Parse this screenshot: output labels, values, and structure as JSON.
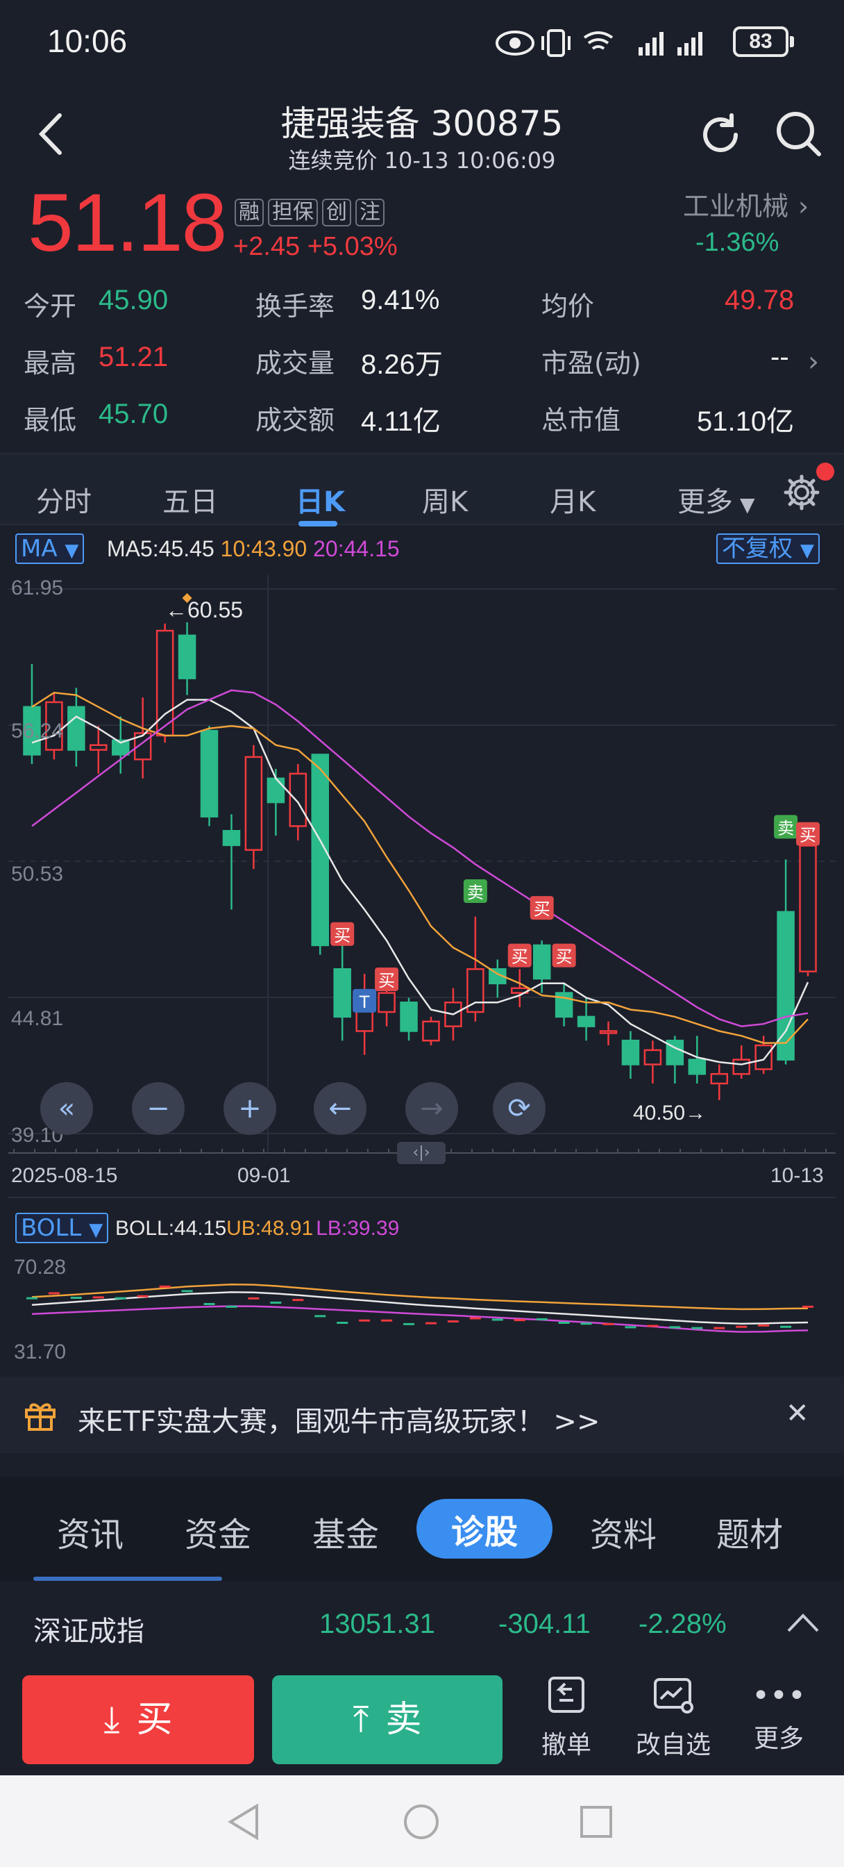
{
  "status": {
    "time": "10:06",
    "battery": "83"
  },
  "header": {
    "title": "捷强装备 300875",
    "subtitle": "连续竞价 10-13 10:06:09"
  },
  "quote": {
    "price": "51.18",
    "tags": [
      "融",
      "担保",
      "创",
      "注"
    ],
    "change": "+2.45  +5.03%",
    "industry": "工业机械",
    "industry_change": "-1.36%"
  },
  "stats": {
    "open_label": "今开",
    "open": "45.90",
    "high_label": "最高",
    "high": "51.21",
    "low_label": "最低",
    "low": "45.70",
    "turnover_label": "换手率",
    "turnover": "9.41%",
    "volume_label": "成交量",
    "volume": "8.26万",
    "amount_label": "成交额",
    "amount": "4.11亿",
    "avg_label": "均价",
    "avg": "49.78",
    "pe_label": "市盈(动)",
    "pe": "--",
    "mcap_label": "总市值",
    "mcap": "51.10亿"
  },
  "ktabs": [
    "分时",
    "五日",
    "日K",
    "周K",
    "月K",
    "更多"
  ],
  "ktab_active": "日K",
  "chart": {
    "ma_label": "MA",
    "ma5": "MA5:45.45",
    "ma10": "10:43.90",
    "ma20": "20:44.15",
    "adjust": "不复权",
    "y_ticks": [
      "61.95",
      "56.24",
      "50.53",
      "44.81",
      "39.10"
    ],
    "x_ticks": [
      "2025-08-15",
      "09-01",
      "10-13"
    ],
    "max_note": "←60.55",
    "min_note": "40.50→",
    "boll_label": "BOLL",
    "boll": "BOLL:44.15",
    "ub": "UB:48.91",
    "lb": "LB:39.39",
    "boll_top": "70.28",
    "boll_bottom": "31.70",
    "signals": [
      "买",
      "卖",
      "T"
    ]
  },
  "chart_data": {
    "type": "candlestick",
    "x_start": "2025-08-15",
    "x_end": "10-13",
    "ylim": [
      39.1,
      61.95
    ],
    "candles": [
      {
        "o": 57.0,
        "c": 55.0,
        "h": 58.8,
        "l": 54.6
      },
      {
        "o": 55.2,
        "c": 57.2,
        "h": 57.6,
        "l": 54.8
      },
      {
        "o": 57.0,
        "c": 55.2,
        "h": 57.8,
        "l": 54.5
      },
      {
        "o": 55.2,
        "c": 55.4,
        "h": 56.2,
        "l": 54.2
      },
      {
        "o": 55.6,
        "c": 55.0,
        "h": 56.6,
        "l": 54.2
      },
      {
        "o": 54.8,
        "c": 55.9,
        "h": 57.4,
        "l": 54.0
      },
      {
        "o": 55.8,
        "c": 60.2,
        "h": 60.5,
        "l": 55.5
      },
      {
        "o": 60.0,
        "c": 58.2,
        "h": 60.55,
        "l": 57.5
      },
      {
        "o": 56.0,
        "c": 52.4,
        "h": 56.2,
        "l": 52.0
      },
      {
        "o": 51.8,
        "c": 51.2,
        "h": 52.5,
        "l": 48.5
      },
      {
        "o": 51.0,
        "c": 54.9,
        "h": 55.4,
        "l": 50.2
      },
      {
        "o": 54.0,
        "c": 53.0,
        "h": 54.4,
        "l": 51.6
      },
      {
        "o": 52.0,
        "c": 54.2,
        "h": 54.6,
        "l": 51.4
      },
      {
        "o": 55.0,
        "c": 47.0,
        "h": 55.0,
        "l": 46.6
      },
      {
        "o": 46.0,
        "c": 44.0,
        "h": 47.5,
        "l": 43.0
      },
      {
        "o": 43.4,
        "c": 45.0,
        "h": 45.8,
        "l": 42.4
      },
      {
        "o": 44.2,
        "c": 45.0,
        "h": 46.0,
        "l": 43.6
      },
      {
        "o": 44.6,
        "c": 43.4,
        "h": 44.8,
        "l": 43.0
      },
      {
        "o": 43.0,
        "c": 43.8,
        "h": 44.0,
        "l": 42.8
      },
      {
        "o": 43.6,
        "c": 44.6,
        "h": 45.2,
        "l": 43.0
      },
      {
        "o": 44.2,
        "c": 46.0,
        "h": 48.2,
        "l": 43.8
      },
      {
        "o": 46.0,
        "c": 45.4,
        "h": 46.4,
        "l": 44.8
      },
      {
        "o": 45.0,
        "c": 45.2,
        "h": 46.0,
        "l": 44.4
      },
      {
        "o": 47.0,
        "c": 45.6,
        "h": 47.2,
        "l": 45.0
      },
      {
        "o": 45.0,
        "c": 44.0,
        "h": 45.4,
        "l": 43.6
      },
      {
        "o": 44.0,
        "c": 43.6,
        "h": 44.8,
        "l": 43.0
      },
      {
        "o": 43.4,
        "c": 43.4,
        "h": 43.8,
        "l": 42.8
      },
      {
        "o": 43.0,
        "c": 42.0,
        "h": 43.4,
        "l": 41.4
      },
      {
        "o": 42.0,
        "c": 42.6,
        "h": 43.0,
        "l": 41.2
      },
      {
        "o": 43.0,
        "c": 42.0,
        "h": 43.2,
        "l": 41.2
      },
      {
        "o": 42.2,
        "c": 41.6,
        "h": 43.2,
        "l": 41.2
      },
      {
        "o": 41.2,
        "c": 41.6,
        "h": 42.0,
        "l": 40.5
      },
      {
        "o": 41.6,
        "c": 42.2,
        "h": 42.8,
        "l": 41.4
      },
      {
        "o": 41.8,
        "c": 42.8,
        "h": 43.2,
        "l": 41.6
      },
      {
        "o": 48.4,
        "c": 42.2,
        "h": 50.6,
        "l": 42.0
      },
      {
        "o": 45.9,
        "c": 51.18,
        "h": 51.21,
        "l": 45.7
      }
    ],
    "ma5": [
      55.5,
      55.8,
      56.6,
      56.1,
      55.5,
      55.8,
      56.7,
      57.3,
      57.3,
      56.8,
      56.1,
      54.0,
      53.0,
      51.4,
      49.7,
      48.5,
      47.2,
      45.6,
      44.3,
      44.1,
      44.6,
      44.6,
      44.9,
      45.4,
      45.4,
      44.8,
      44.5,
      43.7,
      43.2,
      42.7,
      42.3,
      42.1,
      42.0,
      42.2,
      43.4,
      45.45
    ],
    "ma10": [
      57.0,
      57.6,
      57.5,
      57.0,
      56.5,
      56.1,
      55.8,
      55.8,
      56.1,
      56.2,
      56.1,
      55.4,
      55.2,
      54.4,
      53.3,
      52.2,
      50.7,
      49.3,
      47.8,
      46.9,
      46.4,
      45.8,
      45.4,
      44.9,
      44.8,
      44.6,
      44.6,
      44.3,
      44.2,
      44.0,
      43.7,
      43.4,
      43.2,
      42.9,
      42.9,
      43.9
    ],
    "ma20": [
      52.0,
      52.7,
      53.4,
      54.1,
      54.8,
      55.5,
      56.2,
      56.9,
      57.3,
      57.7,
      57.6,
      57.1,
      56.4,
      55.6,
      54.8,
      54.0,
      53.2,
      52.4,
      51.7,
      51.1,
      50.4,
      49.8,
      49.2,
      48.6,
      48.0,
      47.4,
      46.8,
      46.2,
      45.6,
      45.0,
      44.4,
      43.9,
      43.6,
      43.7,
      44.0,
      44.15
    ]
  },
  "banner": {
    "text": "来ETF实盘大赛，围观牛市高级玩家！ >>"
  },
  "info_tabs": [
    "资讯",
    "资金",
    "基金",
    "诊股",
    "资料",
    "题材"
  ],
  "info_active": "诊股",
  "index": {
    "name": "深证成指",
    "value": "13051.31",
    "change": "-304.11",
    "pct": "-2.28%"
  },
  "bottom": {
    "buy": "买",
    "sell": "卖",
    "cancel": "撤单",
    "watch": "改自选",
    "more": "更多"
  }
}
